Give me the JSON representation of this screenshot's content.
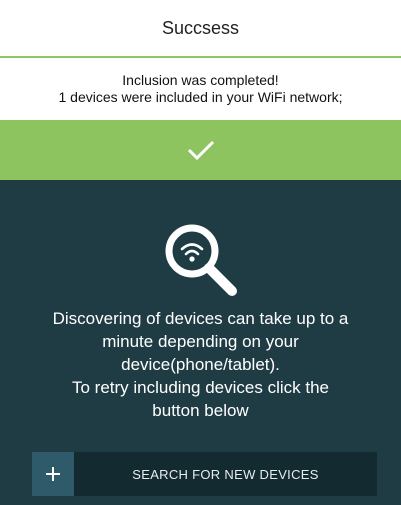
{
  "header": {
    "title": "Succsess"
  },
  "message": {
    "line1": "Inclusion was completed!",
    "line2": "1 devices were included in your WiFi network;"
  },
  "status_icon": "checkmark-icon",
  "main": {
    "icon": "search-wifi-icon",
    "description": [
      "Discovering of devices can take up to a",
      "minute depending on your",
      "device(phone/tablet).",
      "To retry including devices click the",
      "button below"
    ],
    "search_button": {
      "icon": "plus-icon",
      "label": "SEARCH FOR NEW DEVICES"
    }
  },
  "colors": {
    "accent": "#8ec45f",
    "panel": "#1f3c44",
    "button": "#132a31",
    "button_icon_bg": "#2e5a69"
  }
}
